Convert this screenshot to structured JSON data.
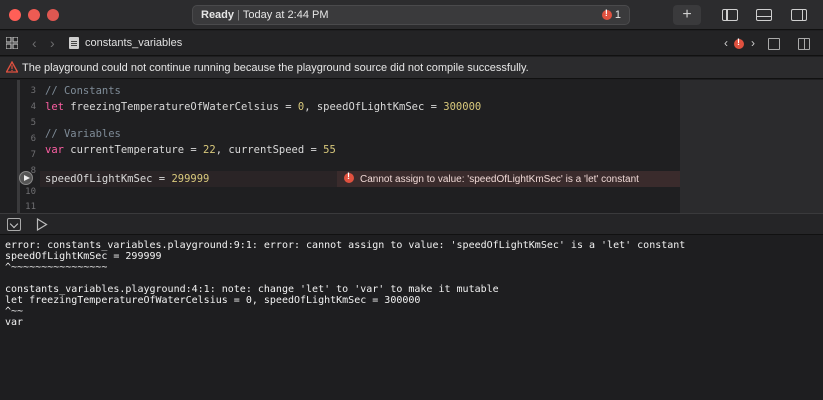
{
  "titlebar": {
    "status_bold": "Ready",
    "status_sep": "|",
    "status_time": "Today at 2:44 PM",
    "error_count": "1",
    "add_label": "+"
  },
  "tabbar": {
    "file_name": "constants_variables",
    "error_count": "1",
    "back": "‹",
    "forward": "›"
  },
  "warning": {
    "text": "The playground could not continue running because the playground source did not compile successfully."
  },
  "editor": {
    "line_numbers": [
      "3",
      "4",
      "5",
      "6",
      "7",
      "8",
      "9",
      "10",
      "11"
    ],
    "lines": {
      "l3": "// Constants",
      "l4_kw": "let",
      "l4_a": " freezingTemperatureOfWaterCelsius = ",
      "l4_n1": "0",
      "l4_b": ", speedOfLightKmSec = ",
      "l4_n2": "300000",
      "l6": "// Variables",
      "l7_kw": "var",
      "l7_a": " currentTemperature = ",
      "l7_n1": "22",
      "l7_b": ", currentSpeed = ",
      "l7_n2": "55",
      "l9_a": "speedOfLightKmSec = ",
      "l9_n": "299999"
    },
    "inline_error": "Cannot assign to value: 'speedOfLightKmSec' is a 'let' constant"
  },
  "console": {
    "lines": [
      "error: constants_variables.playground:9:1: error: cannot assign to value: 'speedOfLightKmSec' is a 'let' constant",
      "speedOfLightKmSec = 299999",
      "^~~~~~~~~~~~~~~~~",
      "",
      "constants_variables.playground:4:1: note: change 'let' to 'var' to make it mutable",
      "let freezingTemperatureOfWaterCelsius = 0, speedOfLightKmSec = 300000",
      "^~~",
      "var"
    ]
  },
  "colors": {
    "keyword": "#fc5fa3",
    "comment": "#7f8c98",
    "number": "#d9c97c",
    "error": "#e0513f"
  }
}
